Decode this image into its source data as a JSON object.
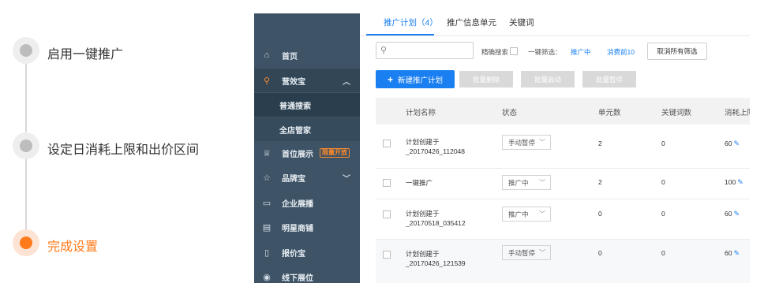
{
  "steps": [
    {
      "label": "启用一键推广",
      "active": false
    },
    {
      "label": "设定日消耗上限和出价区间",
      "active": false
    },
    {
      "label": "完成设置",
      "active": true
    }
  ],
  "colors": {
    "active": "#ff7a1a",
    "inactive": "#bdbdbd",
    "primary": "#1a7ff0",
    "sidebar": "#3e5366"
  },
  "sidebar": {
    "items": [
      {
        "label": "首页",
        "icon": "home-icon"
      },
      {
        "label": "营效宝",
        "icon": "search-icon"
      },
      {
        "label": "普通搜索",
        "icon": ""
      },
      {
        "label": "全店管家",
        "icon": ""
      },
      {
        "label": "首位展示",
        "icon": "crown-icon",
        "badge": "限量开放"
      },
      {
        "label": "品牌宝",
        "icon": "brand-icon"
      },
      {
        "label": "企业展播",
        "icon": "monitor-icon"
      },
      {
        "label": "明星商铺",
        "icon": "store-icon"
      },
      {
        "label": "报价宝",
        "icon": "document-icon"
      },
      {
        "label": "线下展位",
        "icon": "location-icon"
      }
    ]
  },
  "tabs": [
    {
      "label": "推广计划（4）",
      "active": true
    },
    {
      "label": "推广信息单元",
      "active": false
    },
    {
      "label": "关键词",
      "active": false
    }
  ],
  "toolbar": {
    "search_placeholder": "",
    "exact_search_label": "精确搜索",
    "quick_filter_label": "一键筛选：",
    "filter_promoting": "推广中",
    "filter_top10": "消费前10",
    "clear_filters": "取消所有筛选"
  },
  "actions": {
    "new_plan": "新建推广计划",
    "batch_delete": "批量删除",
    "batch_start": "批量启动",
    "batch_pause": "批量暂停"
  },
  "table": {
    "headers": [
      "计划名称",
      "状态",
      "单元数",
      "关键词数",
      "消耗上限"
    ],
    "rows": [
      {
        "name_line1": "计划创建于",
        "name_line2": "_20170426_112048",
        "status": "手动暂停",
        "units": "2",
        "keywords": "0",
        "limit": "60"
      },
      {
        "name_line1": "一键推广",
        "name_line2": "",
        "status": "推广中",
        "units": "2",
        "keywords": "0",
        "limit": "100"
      },
      {
        "name_line1": "计划创建于",
        "name_line2": "_20170518_035412",
        "status": "推广中",
        "units": "0",
        "keywords": "0",
        "limit": "60"
      },
      {
        "name_line1": "计划创建于",
        "name_line2": "_20170426_121539",
        "status": "手动暂停",
        "units": "0",
        "keywords": "0",
        "limit": "60"
      }
    ]
  }
}
